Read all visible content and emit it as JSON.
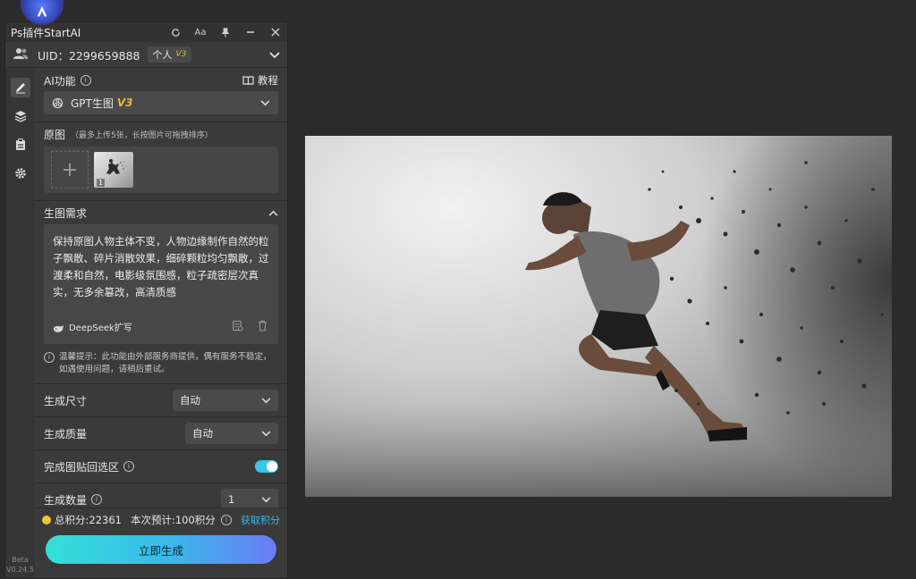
{
  "window": {
    "title": "Ps插件StartAI"
  },
  "user": {
    "uid_text": "UID：2299659888",
    "plan": "个人",
    "plan_version": "V3"
  },
  "ai": {
    "section_label": "AI功能",
    "tutorial_label": "教程",
    "model": "GPT生图",
    "model_version": "V3"
  },
  "source": {
    "label": "原图",
    "note": "（最多上传5张，长按图片可拖拽排序）",
    "thumb_index": "1"
  },
  "requirement": {
    "label": "生图需求",
    "prompt": "保持原图人物主体不变，人物边缘制作自然的粒子飘散、碎片消散效果，细碎颗粒均匀飘散，过渡柔和自然，电影级氛围感，粒子疏密层次真实，无多余篡改，高清质感",
    "deepseek_label": "DeepSeek扩写",
    "tip": "温馨提示：此功能由外部服务商提供，偶有服务不稳定，如遇使用问题，请稍后重试。"
  },
  "settings": {
    "size_label": "生成尺寸",
    "size_value": "自动",
    "quality_label": "生成质量",
    "quality_value": "自动",
    "paste_label": "完成图贴回选区",
    "count_label": "生成数量",
    "count_value": "1"
  },
  "footer": {
    "points_text": "总积分:22361",
    "estimate_text": "本次预计:100积分",
    "get_points": "获取积分",
    "generate_button": "立即生成"
  },
  "sidebar": {
    "version_line1": "Beta",
    "version_line2": "V0.24.5"
  },
  "colors": {
    "accent": "#3bb7ea",
    "badge": "#e8b83a",
    "toggle_on": "#35c8e8"
  }
}
